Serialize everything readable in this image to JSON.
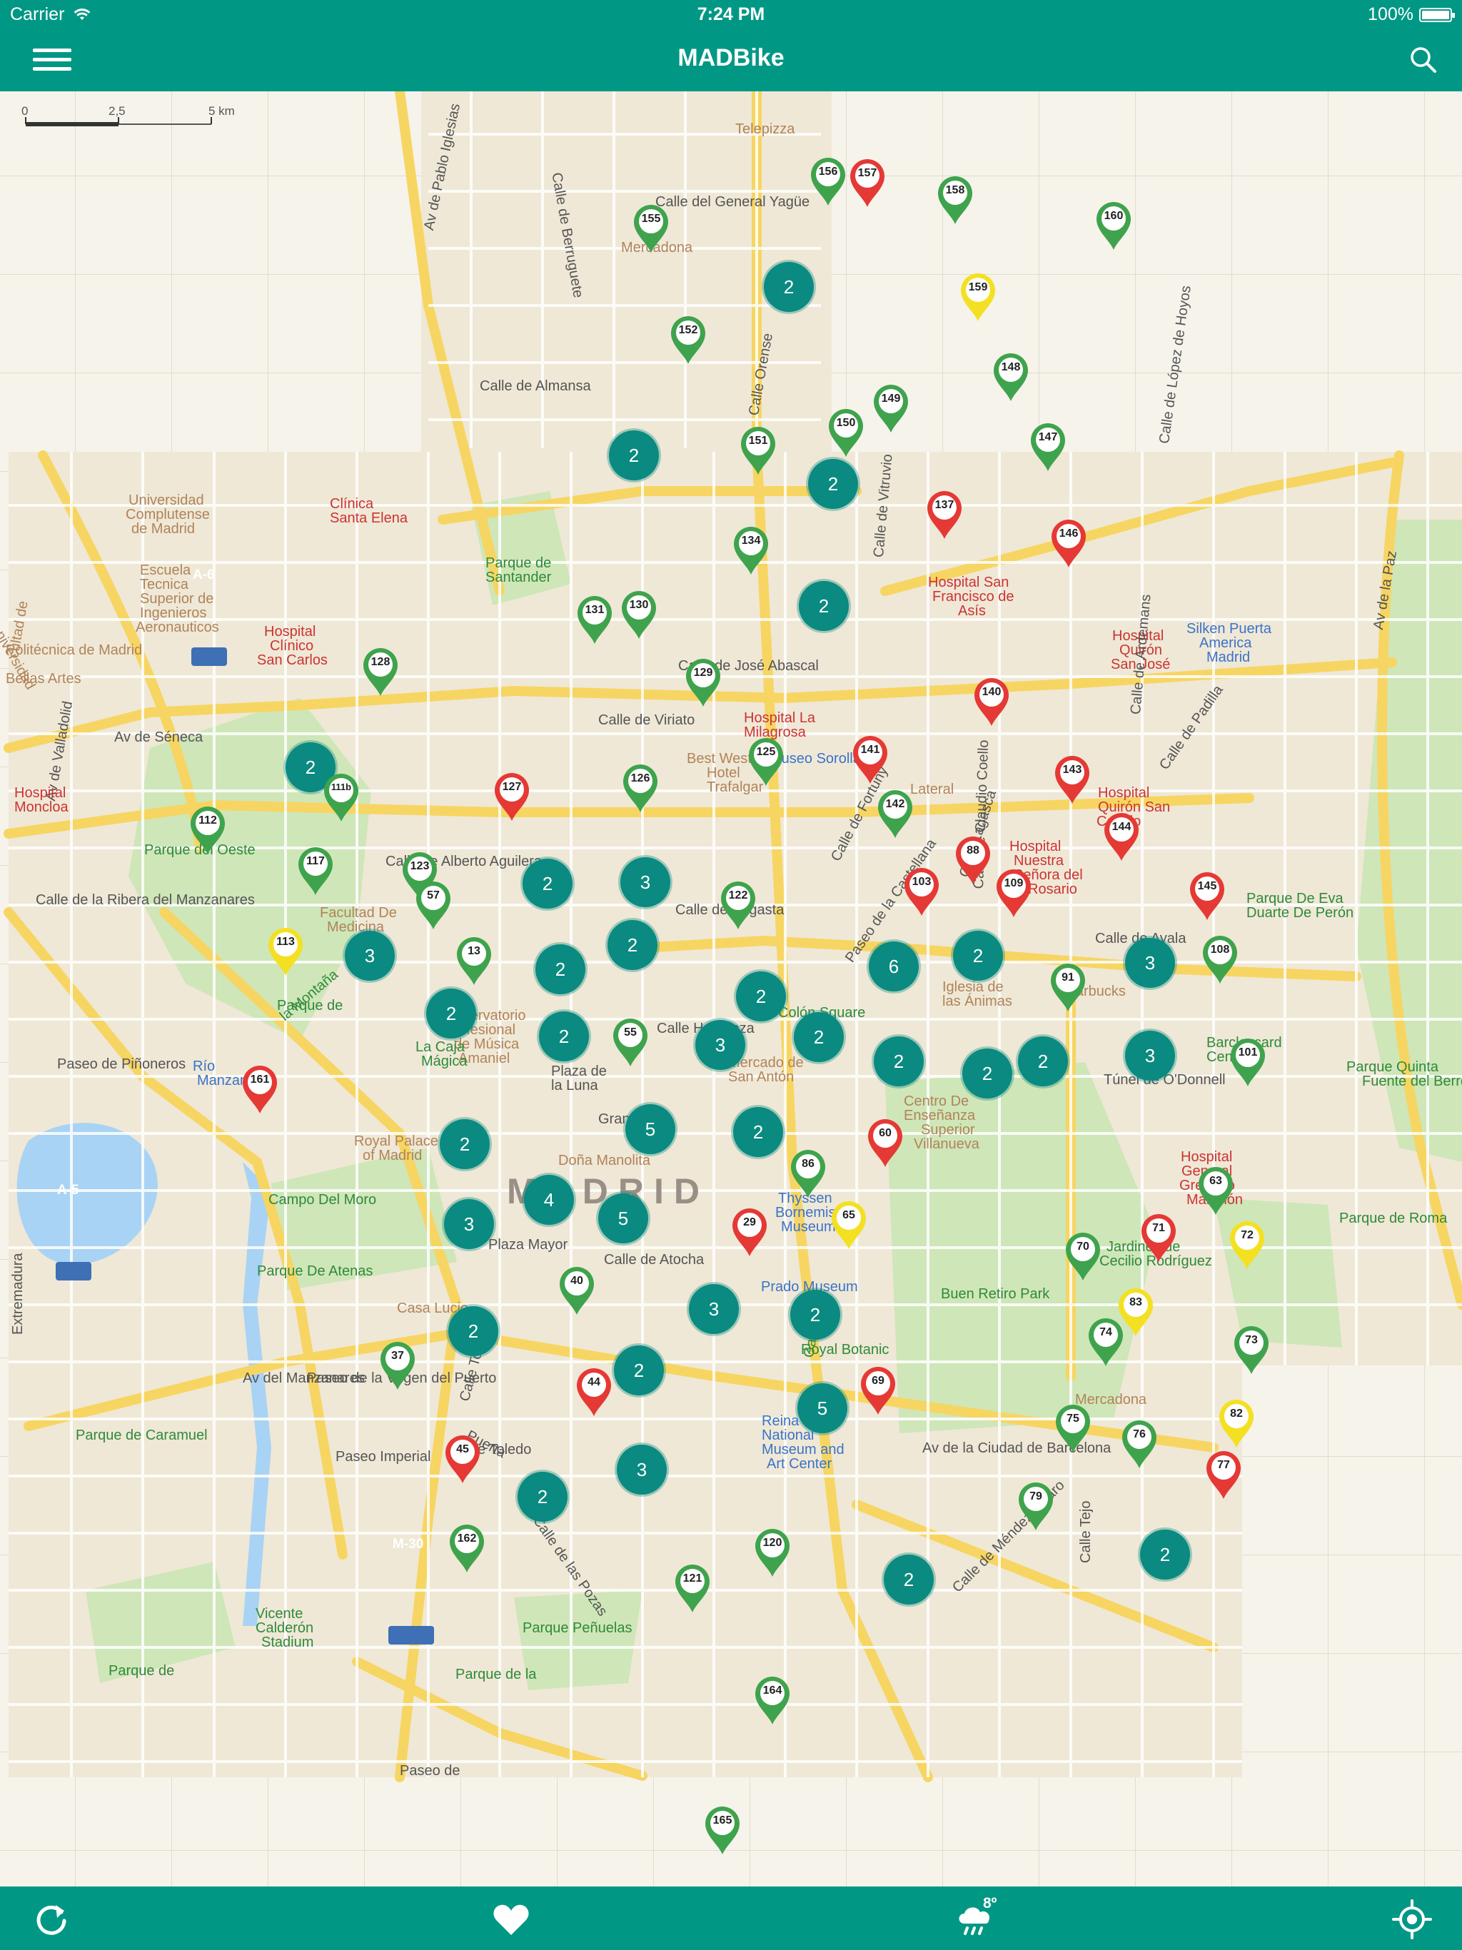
{
  "status_bar": {
    "carrier": "Carrier",
    "time": "7:24 PM",
    "battery": "100%"
  },
  "header": {
    "title": "MADBike"
  },
  "scale": {
    "label_0": "0",
    "label_1": "2,5",
    "label_2": "5 km"
  },
  "colors": {
    "brand": "#009885",
    "available": "#3fa34d",
    "empty": "#e53935",
    "few": "#f4e022",
    "cluster": "#0a8a80"
  },
  "icons": {
    "menu": "hamburger-icon",
    "search": "search-icon",
    "refresh": "refresh-icon",
    "favorites": "heart-icon",
    "weather": "rain-cloud-icon",
    "locate": "locate-icon"
  },
  "weather": {
    "temperature": "8º"
  },
  "stations": [
    {
      "label": "156",
      "status": "available"
    },
    {
      "label": "157",
      "status": "empty"
    },
    {
      "label": "158",
      "status": "available"
    },
    {
      "label": "160",
      "status": "available"
    },
    {
      "label": "155",
      "status": "available"
    },
    {
      "label": "159",
      "status": "few"
    },
    {
      "label": "152",
      "status": "available"
    },
    {
      "label": "148",
      "status": "available"
    },
    {
      "label": "149",
      "status": "available"
    },
    {
      "label": "150",
      "status": "available"
    },
    {
      "label": "151",
      "status": "available"
    },
    {
      "label": "147",
      "status": "available"
    },
    {
      "label": "137",
      "status": "empty"
    },
    {
      "label": "146",
      "status": "empty"
    },
    {
      "label": "134",
      "status": "available"
    },
    {
      "label": "131",
      "status": "available"
    },
    {
      "label": "130",
      "status": "available"
    },
    {
      "label": "129",
      "status": "available"
    },
    {
      "label": "128",
      "status": "available"
    },
    {
      "label": "140",
      "status": "empty"
    },
    {
      "label": "141",
      "status": "empty"
    },
    {
      "label": "125",
      "status": "available"
    },
    {
      "label": "126",
      "status": "available"
    },
    {
      "label": "127",
      "status": "empty"
    },
    {
      "label": "143",
      "status": "empty"
    },
    {
      "label": "142",
      "status": "available"
    },
    {
      "label": "144",
      "status": "empty"
    },
    {
      "label": "111b",
      "status": "available"
    },
    {
      "label": "112",
      "status": "available"
    },
    {
      "label": "117",
      "status": "available"
    },
    {
      "label": "123",
      "status": "available"
    },
    {
      "label": "57",
      "status": "available"
    },
    {
      "label": "88",
      "status": "empty"
    },
    {
      "label": "103",
      "status": "empty"
    },
    {
      "label": "109",
      "status": "empty"
    },
    {
      "label": "145",
      "status": "empty"
    },
    {
      "label": "122",
      "status": "available"
    },
    {
      "label": "113",
      "status": "few"
    },
    {
      "label": "13",
      "status": "available"
    },
    {
      "label": "108",
      "status": "available"
    },
    {
      "label": "91",
      "status": "available"
    },
    {
      "label": "55",
      "status": "available"
    },
    {
      "label": "101",
      "status": "available"
    },
    {
      "label": "161",
      "status": "empty"
    },
    {
      "label": "60",
      "status": "empty"
    },
    {
      "label": "86",
      "status": "available"
    },
    {
      "label": "63",
      "status": "available"
    },
    {
      "label": "29",
      "status": "empty"
    },
    {
      "label": "65",
      "status": "few"
    },
    {
      "label": "70",
      "status": "available"
    },
    {
      "label": "71",
      "status": "empty"
    },
    {
      "label": "72",
      "status": "few"
    },
    {
      "label": "40",
      "status": "available"
    },
    {
      "label": "83",
      "status": "few"
    },
    {
      "label": "73",
      "status": "available"
    },
    {
      "label": "74",
      "status": "available"
    },
    {
      "label": "37",
      "status": "available"
    },
    {
      "label": "44",
      "status": "empty"
    },
    {
      "label": "69",
      "status": "empty"
    },
    {
      "label": "82",
      "status": "few"
    },
    {
      "label": "75",
      "status": "available"
    },
    {
      "label": "76",
      "status": "available"
    },
    {
      "label": "45",
      "status": "empty"
    },
    {
      "label": "77",
      "status": "empty"
    },
    {
      "label": "79",
      "status": "available"
    },
    {
      "label": "162",
      "status": "available"
    },
    {
      "label": "120",
      "status": "available"
    },
    {
      "label": "121",
      "status": "available"
    },
    {
      "label": "164",
      "status": "available"
    },
    {
      "label": "165",
      "status": "available"
    }
  ],
  "clusters": [
    "2",
    "2",
    "2",
    "2",
    "2",
    "3",
    "2",
    "2",
    "3",
    "2",
    "6",
    "2",
    "3",
    "2",
    "2",
    "2",
    "3",
    "2",
    "2",
    "2",
    "2",
    "3",
    "5",
    "2",
    "2",
    "4",
    "5",
    "3",
    "3",
    "2",
    "2",
    "2",
    "5",
    "3",
    "2",
    "2",
    "2"
  ],
  "map_labels": [
    {
      "text": "Telepizza",
      "kind": "poi"
    },
    {
      "text": "Calle de Berruguete",
      "kind": "road"
    },
    {
      "text": "Calle del General Yagüe",
      "kind": "road"
    },
    {
      "text": "Mercadona",
      "kind": "poi"
    },
    {
      "text": "Av de Pablo Iglesias",
      "kind": "road"
    },
    {
      "text": "Calle de Almansa",
      "kind": "road"
    },
    {
      "text": "Calle Orense",
      "kind": "road"
    },
    {
      "text": "Universidad",
      "kind": "poi"
    },
    {
      "text": "Complutense",
      "kind": "poi"
    },
    {
      "text": "de Madrid",
      "kind": "poi"
    },
    {
      "text": "Clínica",
      "kind": "red"
    },
    {
      "text": "Santa Elena",
      "kind": "red"
    },
    {
      "text": "Parque de",
      "kind": "park"
    },
    {
      "text": "Santander",
      "kind": "park"
    },
    {
      "text": "Escuela",
      "kind": "poi"
    },
    {
      "text": "Tecnica",
      "kind": "poi"
    },
    {
      "text": "Superior de",
      "kind": "poi"
    },
    {
      "text": "Ingenieros",
      "kind": "poi"
    },
    {
      "text": "Aeronauticos",
      "kind": "poi"
    },
    {
      "text": "Hospital",
      "kind": "red"
    },
    {
      "text": "Clínico",
      "kind": "red"
    },
    {
      "text": "San Carlos",
      "kind": "red"
    },
    {
      "text": "Calle de José Abascal",
      "kind": "road"
    },
    {
      "text": "Hospital La",
      "kind": "red"
    },
    {
      "text": "Milagrosa",
      "kind": "red"
    },
    {
      "text": "Hospital San",
      "kind": "red"
    },
    {
      "text": "Francisco de",
      "kind": "red"
    },
    {
      "text": "Asís",
      "kind": "red"
    },
    {
      "text": "Hospital",
      "kind": "red"
    },
    {
      "text": "Quirón",
      "kind": "red"
    },
    {
      "text": "San José",
      "kind": "red"
    },
    {
      "text": "Silken Puerta",
      "kind": "blue"
    },
    {
      "text": "America",
      "kind": "blue"
    },
    {
      "text": "Madrid",
      "kind": "blue"
    },
    {
      "text": "Av de Séneca",
      "kind": "road"
    },
    {
      "text": "Calle de Viriato",
      "kind": "road"
    },
    {
      "text": "Best Western",
      "kind": "poi"
    },
    {
      "text": "Hotel",
      "kind": "poi"
    },
    {
      "text": "Trafalgar",
      "kind": "poi"
    },
    {
      "text": "Museo Sorolla",
      "kind": "blue"
    },
    {
      "text": "Lateral",
      "kind": "poi"
    },
    {
      "text": "Hospital",
      "kind": "red"
    },
    {
      "text": "Quirón San",
      "kind": "red"
    },
    {
      "text": "Camilo",
      "kind": "red"
    },
    {
      "text": "Hospital",
      "kind": "red"
    },
    {
      "text": "Nuestra",
      "kind": "red"
    },
    {
      "text": "Señora del",
      "kind": "red"
    },
    {
      "text": "Rosario",
      "kind": "red"
    },
    {
      "text": "Parque del Oeste",
      "kind": "park"
    },
    {
      "text": "Calle de Alberto Aguilera",
      "kind": "road"
    },
    {
      "text": "Facultad De",
      "kind": "poi"
    },
    {
      "text": "Medicina",
      "kind": "poi"
    },
    {
      "text": "Parque De Eva",
      "kind": "park"
    },
    {
      "text": "Duarte De Perón",
      "kind": "park"
    },
    {
      "text": "Calle de Ayala",
      "kind": "road"
    },
    {
      "text": "Parque de",
      "kind": "park"
    },
    {
      "text": "la Montaña",
      "kind": "park"
    },
    {
      "text": "Observatorio",
      "kind": "poi"
    },
    {
      "text": "Profesional",
      "kind": "poi"
    },
    {
      "text": "de Música",
      "kind": "poi"
    },
    {
      "text": "Amaniel",
      "kind": "poi"
    },
    {
      "text": "Plaza de",
      "kind": "road"
    },
    {
      "text": "la Luna",
      "kind": "road"
    },
    {
      "text": "Calle Hortaleza",
      "kind": "road"
    },
    {
      "text": "Mercado de",
      "kind": "poi"
    },
    {
      "text": "San Antón",
      "kind": "poi"
    },
    {
      "text": "Colón Square",
      "kind": "park"
    },
    {
      "text": "Calle de Sagasta",
      "kind": "road"
    },
    {
      "text": "Iglesia de",
      "kind": "poi"
    },
    {
      "text": "las Ánimas",
      "kind": "poi"
    },
    {
      "text": "Starbucks",
      "kind": "poi"
    },
    {
      "text": "Barclaycard",
      "kind": "park"
    },
    {
      "text": "Center",
      "kind": "park"
    },
    {
      "text": "Túnel de O'Donnell",
      "kind": "road"
    },
    {
      "text": "Parque Quinta",
      "kind": "park"
    },
    {
      "text": "Fuente del Berro",
      "kind": "park"
    },
    {
      "text": "Río",
      "kind": "blue"
    },
    {
      "text": "Manzanares",
      "kind": "blue"
    },
    {
      "text": "La Caja",
      "kind": "park"
    },
    {
      "text": "Mágica",
      "kind": "park"
    },
    {
      "text": "Royal Palace",
      "kind": "poi"
    },
    {
      "text": "of Madrid",
      "kind": "poi"
    },
    {
      "text": "Gran Vía",
      "kind": "road"
    },
    {
      "text": "Centro De",
      "kind": "poi"
    },
    {
      "text": "Enseñanza",
      "kind": "poi"
    },
    {
      "text": "Superior",
      "kind": "poi"
    },
    {
      "text": "Villanueva",
      "kind": "poi"
    },
    {
      "text": "Doña Manolita",
      "kind": "poi"
    },
    {
      "text": "MADRID",
      "kind": "big"
    },
    {
      "text": "Campo Del Moro",
      "kind": "park"
    },
    {
      "text": "Thyssen",
      "kind": "blue"
    },
    {
      "text": "Bornemisza",
      "kind": "blue"
    },
    {
      "text": "Museum",
      "kind": "blue"
    },
    {
      "text": "Hospital",
      "kind": "red"
    },
    {
      "text": "General",
      "kind": "red"
    },
    {
      "text": "Gregorio",
      "kind": "red"
    },
    {
      "text": "Marañón",
      "kind": "red"
    },
    {
      "text": "Parque de Roma",
      "kind": "park"
    },
    {
      "text": "Plaza Mayor",
      "kind": "road"
    },
    {
      "text": "Calle de Atocha",
      "kind": "road"
    },
    {
      "text": "Prado Museum",
      "kind": "blue"
    },
    {
      "text": "Jardines de",
      "kind": "park"
    },
    {
      "text": "Cecilio Rodríguez",
      "kind": "park"
    },
    {
      "text": "Parque De Atenas",
      "kind": "park"
    },
    {
      "text": "Buen Retiro Park",
      "kind": "park"
    },
    {
      "text": "Extremadura",
      "kind": "road"
    },
    {
      "text": "Casa Lucio",
      "kind": "poi"
    },
    {
      "text": "Calle Toledo",
      "kind": "road"
    },
    {
      "text": "Royal Botanic",
      "kind": "park"
    },
    {
      "text": "Garden",
      "kind": "park"
    },
    {
      "text": "Mercadona",
      "kind": "poi"
    },
    {
      "text": "Parque de Caramuel",
      "kind": "park"
    },
    {
      "text": "Paseo Imperial",
      "kind": "road"
    },
    {
      "text": "Reina Sofía",
      "kind": "blue"
    },
    {
      "text": "National",
      "kind": "blue"
    },
    {
      "text": "Museum and",
      "kind": "blue"
    },
    {
      "text": "Art Center",
      "kind": "blue"
    },
    {
      "text": "Puerta",
      "kind": "road"
    },
    {
      "text": "de Toledo",
      "kind": "road"
    },
    {
      "text": "Av de la Ciudad de Barcelona",
      "kind": "road"
    },
    {
      "text": "Vicente",
      "kind": "park"
    },
    {
      "text": "Calderón",
      "kind": "park"
    },
    {
      "text": "Stadium",
      "kind": "park"
    },
    {
      "text": "Parque Peñuelas",
      "kind": "park"
    },
    {
      "text": "Parque de",
      "kind": "park"
    },
    {
      "text": "Parque de la",
      "kind": "park"
    },
    {
      "text": "A-6",
      "kind": "blue"
    },
    {
      "text": "A-5",
      "kind": "blue"
    },
    {
      "text": "M-30",
      "kind": "blue"
    },
    {
      "text": "Paseo de Piñoneros",
      "kind": "road"
    },
    {
      "text": "Calle de la Ribera del Manzanares",
      "kind": "road"
    },
    {
      "text": "Av de Valladolid",
      "kind": "road"
    },
    {
      "text": "Paseo de la Virgen del Puerto",
      "kind": "road"
    },
    {
      "text": "Av del Manzanares",
      "kind": "road"
    },
    {
      "text": "Paseo de la Castellana",
      "kind": "road"
    },
    {
      "text": "Calle de Fortuny",
      "kind": "road"
    },
    {
      "text": "Calle Lagasca",
      "kind": "road"
    },
    {
      "text": "Calle de Claudio Coello",
      "kind": "road"
    },
    {
      "text": "Calle de Vitruvio",
      "kind": "road"
    },
    {
      "text": "Calle de López de Hoyos",
      "kind": "road"
    },
    {
      "text": "Calle de Ardemans",
      "kind": "road"
    },
    {
      "text": "Av de la Paz",
      "kind": "road"
    },
    {
      "text": "Calle de Padilla",
      "kind": "road"
    },
    {
      "text": "Calle de Méndez Álvaro",
      "kind": "road"
    },
    {
      "text": "Calle de las Pozas",
      "kind": "road"
    },
    {
      "text": "Calle Tejo",
      "kind": "road"
    },
    {
      "text": "Paseo de",
      "kind": "road"
    },
    {
      "text": "niversidad",
      "kind": "poi"
    },
    {
      "text": "Politécnica de Madrid",
      "kind": "poi"
    },
    {
      "text": "cultad de",
      "kind": "poi"
    },
    {
      "text": "Bellas Artes",
      "kind": "poi"
    },
    {
      "text": "Hospital",
      "kind": "red"
    },
    {
      "text": "Moncloa",
      "kind": "red"
    }
  ]
}
